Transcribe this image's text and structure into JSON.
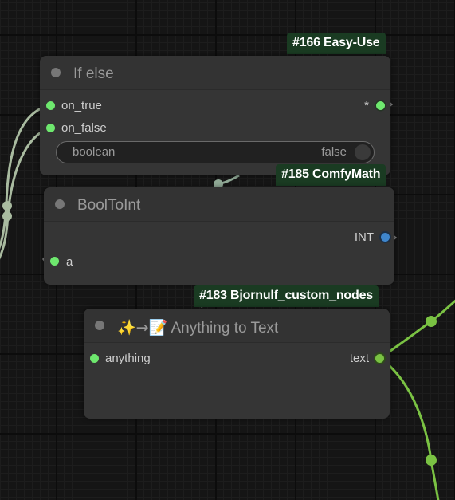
{
  "canvas": {
    "background": "#151515",
    "link_colors": {
      "boolean": "#94a889",
      "int": "#7a9a8a",
      "any": "#7ac243"
    }
  },
  "nodes": {
    "if_else": {
      "badge": "#166 Easy-Use",
      "title": "If else",
      "inputs": [
        "on_true",
        "on_false"
      ],
      "output": "*",
      "widget": {
        "name": "boolean",
        "value": "false"
      }
    },
    "bool_to_int": {
      "badge": "#185 ComfyMath",
      "title": "BoolToInt",
      "output": "INT",
      "input": "a"
    },
    "anything_to_text": {
      "badge": "#183 Bjornulf_custom_nodes",
      "title_icons": "✨→📝",
      "title": "Anything to Text",
      "input": "anything",
      "output": "text"
    }
  },
  "icons": {
    "collapse": "circle-collapse-icon",
    "slot": "slot-dot-icon",
    "reroute": "reroute-dot-icon"
  }
}
